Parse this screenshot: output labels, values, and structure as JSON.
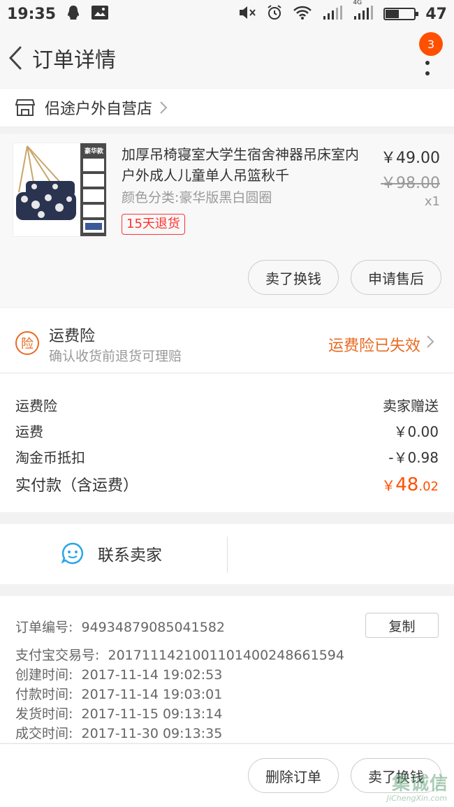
{
  "status_bar": {
    "time": "19:35",
    "battery": "47",
    "battery_fraction": 0.47,
    "network": "4G"
  },
  "nav": {
    "title": "订单详情",
    "badge_count": "3"
  },
  "store": {
    "name": "侣途户外自营店"
  },
  "product": {
    "title": "加厚吊椅寝室大学生宿舍神器吊床室内户外成人儿童单人吊篮秋千",
    "image_label": "豪华款",
    "variant": "颜色分类:豪华版黑白圆圈",
    "return_tag": "15天退货",
    "price": "￥49.00",
    "original_price": "￥98.00",
    "quantity": "x1",
    "buttons": {
      "sell": "卖了换钱",
      "after_sale": "申请售后"
    }
  },
  "insurance": {
    "icon_text": "险",
    "title": "运费险",
    "subtitle": "确认收货前退货可理赔",
    "status": "运费险已失效"
  },
  "fees": {
    "rows": [
      {
        "label": "运费险",
        "value": "卖家赠送"
      },
      {
        "label": "运费",
        "value": "￥0.00"
      },
      {
        "label": "淘金币抵扣",
        "value": "-￥0.98"
      }
    ],
    "total_label": "实付款（含运费）",
    "total_currency": "￥",
    "total_int": "48",
    "total_dec": ".02"
  },
  "contact": {
    "label": "联系卖家"
  },
  "order_info": {
    "copy_label": "复制",
    "rows": [
      {
        "label": "订单编号:",
        "value": "94934879085041582"
      },
      {
        "label": "支付宝交易号:",
        "value": "2017111421001101400248661594"
      },
      {
        "label": "创建时间:",
        "value": "2017-11-14 19:02:53"
      },
      {
        "label": "付款时间:",
        "value": "2017-11-14 19:03:01"
      },
      {
        "label": "发货时间:",
        "value": "2017-11-15 09:13:14"
      },
      {
        "label": "成交时间:",
        "value": "2017-11-30 09:13:35"
      }
    ]
  },
  "bottom": {
    "delete_label": "删除订单",
    "sell_label": "卖了换钱"
  },
  "watermark": {
    "main": "集诚信",
    "sub": "JiChengXin.com"
  },
  "colors": {
    "accent": "#ff5000",
    "insurance": "#e86a20",
    "return_tag": "#ff3333",
    "contact_icon": "#2aa6e8"
  }
}
